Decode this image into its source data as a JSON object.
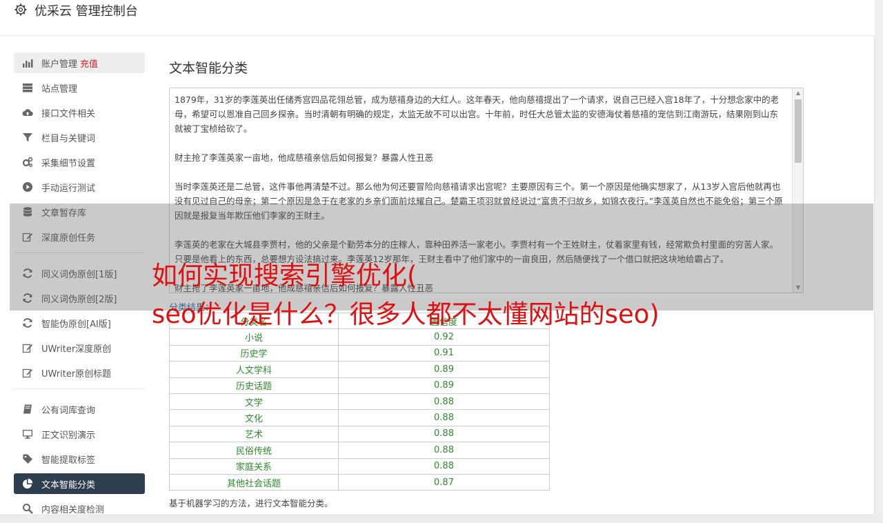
{
  "app": {
    "title": "优采云 管理控制台"
  },
  "sidebar": {
    "items": [
      {
        "label": "账户管理",
        "badge": "充值",
        "icon": "bar-chart-icon",
        "state": "hover"
      },
      {
        "label": "站点管理",
        "icon": "server-icon"
      },
      {
        "label": "接口文件相关",
        "icon": "cloud-upload-icon"
      },
      {
        "label": "栏目与关键词",
        "icon": "filter-icon"
      },
      {
        "label": "采集细节设置",
        "icon": "gears-icon"
      },
      {
        "label": "手动运行测试",
        "icon": "play-circle-icon"
      },
      {
        "label": "文章暂存库",
        "icon": "database-icon"
      },
      {
        "label": "深度原创任务",
        "icon": "edit-icon"
      }
    ],
    "items2": [
      {
        "label": "同义词伪原创[1版]",
        "icon": "refresh-icon"
      },
      {
        "label": "同义词伪原创[2版]",
        "icon": "refresh-icon"
      },
      {
        "label": "智能伪原创[AI版]",
        "icon": "refresh-icon"
      },
      {
        "label": "UWriter深度原创",
        "icon": "edit-icon"
      },
      {
        "label": "UWriter原创标题",
        "icon": "edit-icon"
      }
    ],
    "items3": [
      {
        "label": "公有词库查询",
        "icon": "book-icon"
      },
      {
        "label": "正文识别演示",
        "icon": "monitor-icon"
      },
      {
        "label": "智能提取标签",
        "icon": "tag-icon"
      },
      {
        "label": "文本智能分类",
        "icon": "pie-chart-icon",
        "state": "active"
      },
      {
        "label": "内容相关度检测",
        "icon": "search-icon"
      }
    ]
  },
  "main": {
    "title": "文本智能分类",
    "text": "1879年，31岁的李莲英出任储秀宫四品花翎总管，成为慈禧身边的大红人。这年春天，他向慈禧提出了一个请求，说自己已经入宫18年了，十分想念家中的老母，希望可以恩准自己回乡探亲。当时清朝有明确的规定，太监无故不可以出宫。十年前，时任大总管太监的安德海仗着慈禧的宠信到江南游玩，结果刚到山东就被丁宝桢给砍了。\n\n财主抢了李莲英家一亩地，他成慈禧亲信后如何报复？暴露人性丑恶\n\n当时李莲英还是二总管，这件事他再清楚不过。那么他为何还要冒险向慈禧请求出宫呢？主要原因有三个。第一个原因是他确实想家了，从13岁入宫后他就再也没有见过自己的母亲；第二个原因是急于在老家的乡亲们面前炫耀自己。楚霸王项羽就曾经说过“富贵不归故乡，如锦衣夜行。”李莲英自然也不能免俗；第三个原因就是报复当年欺压他们李家的王财主。\n\n李莲英的老家在大城县李贾村，他的父亲是个勤劳本分的庄稼人，靠种田养活一家老小。李贾村有一个王姓财主，仗着家里有钱，经常欺负村里面的穷苦人家。只要是他看上的东西，总要想方设法搞过来。李莲英12岁那年，王财主看中了他们家中的一亩良田，然后随便找了一个借口就把这块地给霸占了。\n\n财主抢了李莲英家一亩地，他成慈禧亲信后如何报复？暴露人性丑恶",
    "result_label": "分类结果：",
    "table": {
      "headers": [
        "分类名",
        "置信度"
      ],
      "rows": [
        [
          "小说",
          "0.92"
        ],
        [
          "历史学",
          "0.91"
        ],
        [
          "人文学科",
          "0.89"
        ],
        [
          "历史话题",
          "0.89"
        ],
        [
          "文学",
          "0.88"
        ],
        [
          "文化",
          "0.88"
        ],
        [
          "艺术",
          "0.88"
        ],
        [
          "民俗传统",
          "0.88"
        ],
        [
          "家庭关系",
          "0.88"
        ],
        [
          "其他社会话题",
          "0.87"
        ]
      ]
    },
    "note": "基于机器学习的方法，进行文本智能分类。"
  },
  "overlay": {
    "line1": "如何实现搜索引擎优化(",
    "line2": "seo优化是什么？很多人都不太懂网站的seo)"
  },
  "colors": {
    "active_bg": "#2f3e4e",
    "charge": "#e02020",
    "table_text": "#2d8a2d",
    "overlay_text": "#e01010"
  }
}
